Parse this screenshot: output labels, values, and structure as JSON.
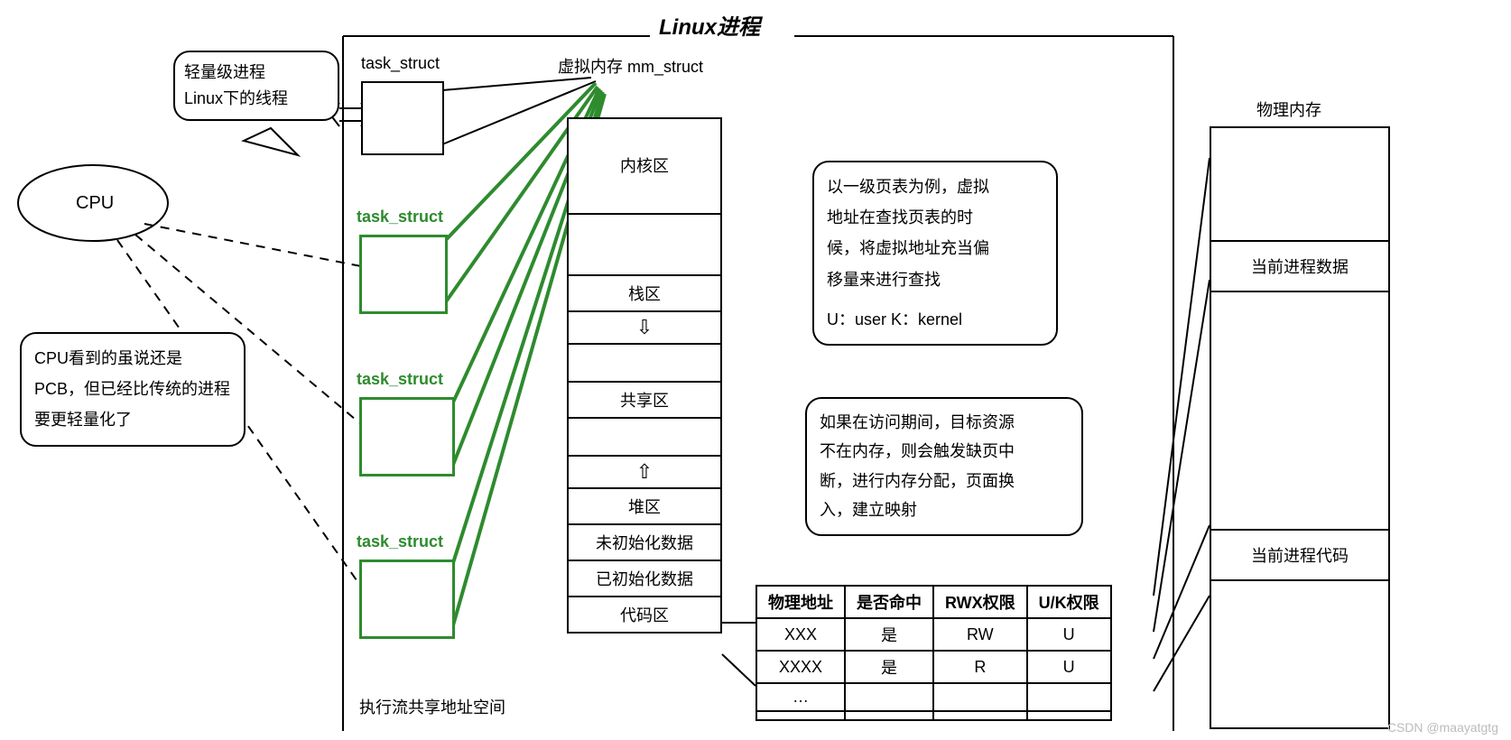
{
  "title": "Linux进程",
  "cpu": {
    "label": "CPU"
  },
  "bubble_lwp": {
    "l1": "轻量级进程",
    "l2": "Linux下的线程"
  },
  "bubble_pcb": "CPU看到的虽说还是PCB，但已经比传统的进程要更轻量化了",
  "task_black": "task_struct",
  "task_green": "task_struct",
  "mm_label": "虚拟内存 mm_struct",
  "mem": {
    "kernel": "内核区",
    "stack": "栈区",
    "shared": "共享区",
    "heap": "堆区",
    "bss": "未初始化数据",
    "data": "已初始化数据",
    "code": "代码区"
  },
  "arrows": {
    "down": "⇩",
    "up": "⇧"
  },
  "share_line": "执行流共享地址空间",
  "note_vpt": {
    "l1": "以一级页表为例，虚拟",
    "l2": "地址在查找页表的时",
    "l3": "候，将虚拟地址充当偏",
    "l4": "移量来进行查找",
    "l5": "U：user  K：kernel"
  },
  "note_fault": {
    "l1": "如果在访问期间，目标资源",
    "l2": "不在内存，则会触发缺页中",
    "l3": "断，进行内存分配，页面换",
    "l4": "入，建立映射"
  },
  "ptable": {
    "headers": [
      "物理地址",
      "是否命中",
      "RWX权限",
      "U/K权限"
    ],
    "rows": [
      [
        "XXX",
        "是",
        "RW",
        "U"
      ],
      [
        "XXXX",
        "是",
        "R",
        "U"
      ],
      [
        "…",
        "",
        "",
        ""
      ],
      [
        "",
        "",
        "",
        ""
      ]
    ]
  },
  "phys": {
    "title": "物理内存",
    "data": "当前进程数据",
    "code": "当前进程代码"
  },
  "watermark": "CSDN @maayatgtg"
}
